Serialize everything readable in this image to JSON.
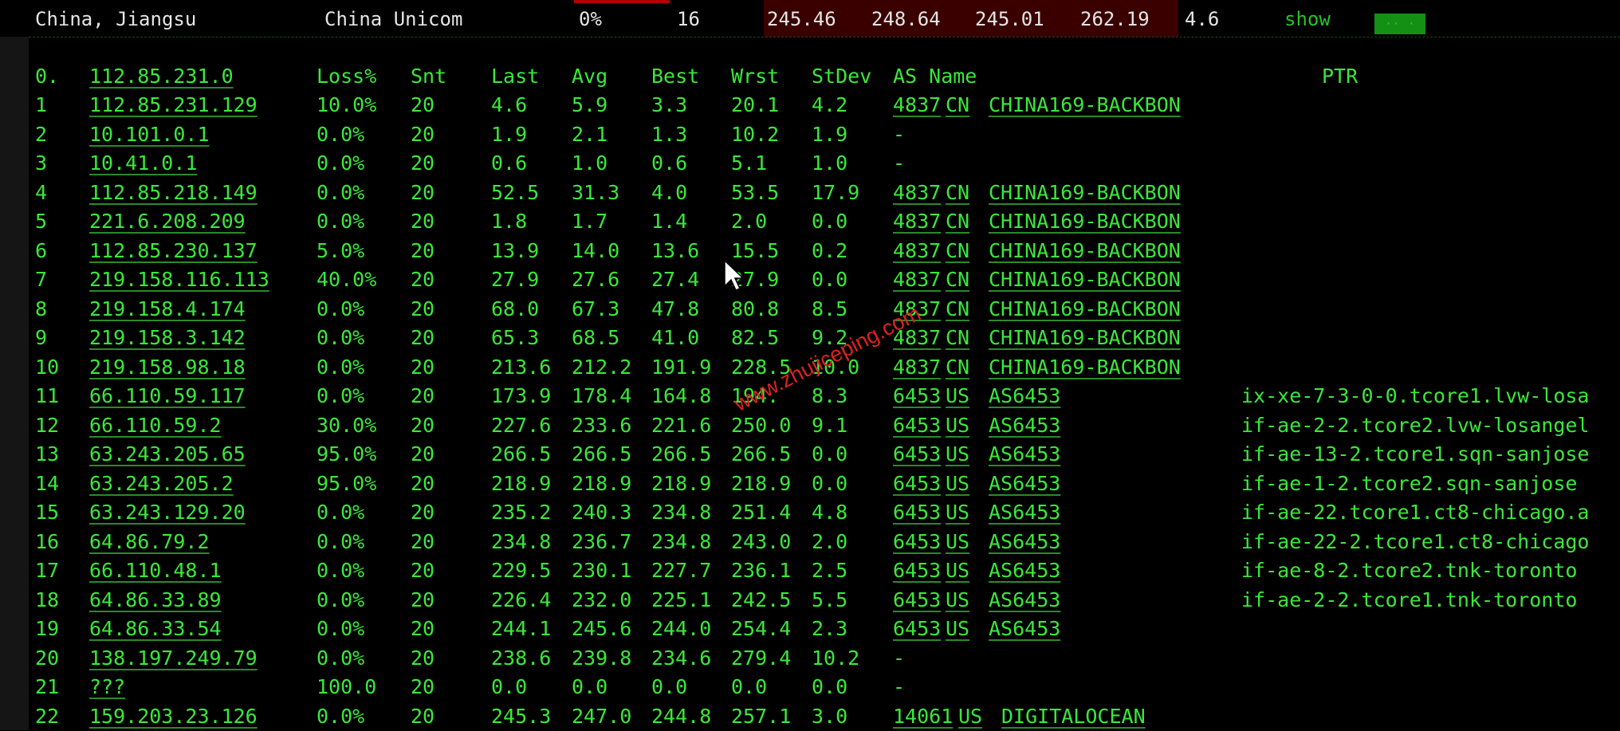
{
  "summary": {
    "location": "China, Jiangsu",
    "isp": "China Unicom",
    "loss": "0%",
    "sent": "16",
    "last": "245.46",
    "avg": "248.64",
    "best": "245.01",
    "worst": "262.19",
    "stdev": "4.6",
    "show_label": "show",
    "pill_text": "·· ·"
  },
  "columns": {
    "hop": "0.",
    "host": "112.85.231.0",
    "loss": "Loss%",
    "snt": "Snt",
    "last": "Last",
    "avg": "Avg",
    "best": "Best",
    "wrst": "Wrst",
    "stdev": "StDev",
    "as_name": "AS Name",
    "ptr": "PTR"
  },
  "hops": [
    {
      "hop": "1",
      "host": "112.85.231.129",
      "loss": "10.0%",
      "snt": "20",
      "last": "4.6",
      "avg": "5.9",
      "best": "3.3",
      "wrst": "20.1",
      "stdev": "4.2",
      "asn": "4837",
      "cc": "CN",
      "asname": "CHINA169-BACKBON",
      "ptr": ""
    },
    {
      "hop": "2",
      "host": "10.101.0.1",
      "loss": "0.0%",
      "snt": "20",
      "last": "1.9",
      "avg": "2.1",
      "best": "1.3",
      "wrst": "10.2",
      "stdev": "1.9",
      "asn": "-",
      "cc": "",
      "asname": "",
      "ptr": ""
    },
    {
      "hop": "3",
      "host": "10.41.0.1",
      "loss": "0.0%",
      "snt": "20",
      "last": "0.6",
      "avg": "1.0",
      "best": "0.6",
      "wrst": "5.1",
      "stdev": "1.0",
      "asn": "-",
      "cc": "",
      "asname": "",
      "ptr": ""
    },
    {
      "hop": "4",
      "host": "112.85.218.149",
      "loss": "0.0%",
      "snt": "20",
      "last": "52.5",
      "avg": "31.3",
      "best": "4.0",
      "wrst": "53.5",
      "stdev": "17.9",
      "asn": "4837",
      "cc": "CN",
      "asname": "CHINA169-BACKBON",
      "ptr": ""
    },
    {
      "hop": "5",
      "host": "221.6.208.209",
      "loss": "0.0%",
      "snt": "20",
      "last": "1.8",
      "avg": "1.7",
      "best": "1.4",
      "wrst": "2.0",
      "stdev": "0.0",
      "asn": "4837",
      "cc": "CN",
      "asname": "CHINA169-BACKBON",
      "ptr": ""
    },
    {
      "hop": "6",
      "host": "112.85.230.137",
      "loss": "5.0%",
      "snt": "20",
      "last": "13.9",
      "avg": "14.0",
      "best": "13.6",
      "wrst": "15.5",
      "stdev": "0.2",
      "asn": "4837",
      "cc": "CN",
      "asname": "CHINA169-BACKBON",
      "ptr": ""
    },
    {
      "hop": "7",
      "host": "219.158.116.113",
      "loss": "40.0%",
      "snt": "20",
      "last": "27.9",
      "avg": "27.6",
      "best": "27.4",
      "wrst": "27.9",
      "stdev": "0.0",
      "asn": "4837",
      "cc": "CN",
      "asname": "CHINA169-BACKBON",
      "ptr": ""
    },
    {
      "hop": "8",
      "host": "219.158.4.174",
      "loss": "0.0%",
      "snt": "20",
      "last": "68.0",
      "avg": "67.3",
      "best": "47.8",
      "wrst": "80.8",
      "stdev": "8.5",
      "asn": "4837",
      "cc": "CN",
      "asname": "CHINA169-BACKBON",
      "ptr": ""
    },
    {
      "hop": "9",
      "host": "219.158.3.142",
      "loss": "0.0%",
      "snt": "20",
      "last": "65.3",
      "avg": "68.5",
      "best": "41.0",
      "wrst": "82.5",
      "stdev": "9.2",
      "asn": "4837",
      "cc": "CN",
      "asname": "CHINA169-BACKBON",
      "ptr": ""
    },
    {
      "hop": "10",
      "host": "219.158.98.18",
      "loss": "0.0%",
      "snt": "20",
      "last": "213.6",
      "avg": "212.2",
      "best": "191.9",
      "wrst": "228.5",
      "stdev": "10.0",
      "asn": "4837",
      "cc": "CN",
      "asname": "CHINA169-BACKBON",
      "ptr": ""
    },
    {
      "hop": "11",
      "host": "66.110.59.117",
      "loss": "0.0%",
      "snt": "20",
      "last": "173.9",
      "avg": "178.4",
      "best": "164.8",
      "wrst": "194.",
      "stdev": "8.3",
      "asn": "6453",
      "cc": "US",
      "asname": "AS6453",
      "ptr": "ix-xe-7-3-0-0.tcore1.lvw-losa"
    },
    {
      "hop": "12",
      "host": "66.110.59.2",
      "loss": "30.0%",
      "snt": "20",
      "last": "227.6",
      "avg": "233.6",
      "best": "221.6",
      "wrst": "250.0",
      "stdev": "9.1",
      "asn": "6453",
      "cc": "US",
      "asname": "AS6453",
      "ptr": "if-ae-2-2.tcore2.lvw-losangel"
    },
    {
      "hop": "13",
      "host": "63.243.205.65",
      "loss": "95.0%",
      "snt": "20",
      "last": "266.5",
      "avg": "266.5",
      "best": "266.5",
      "wrst": "266.5",
      "stdev": "0.0",
      "asn": "6453",
      "cc": "US",
      "asname": "AS6453",
      "ptr": "if-ae-13-2.tcore1.sqn-sanjose"
    },
    {
      "hop": "14",
      "host": "63.243.205.2",
      "loss": "95.0%",
      "snt": "20",
      "last": "218.9",
      "avg": "218.9",
      "best": "218.9",
      "wrst": "218.9",
      "stdev": "0.0",
      "asn": "6453",
      "cc": "US",
      "asname": "AS6453",
      "ptr": "if-ae-1-2.tcore2.sqn-sanjose"
    },
    {
      "hop": "15",
      "host": "63.243.129.20",
      "loss": "0.0%",
      "snt": "20",
      "last": "235.2",
      "avg": "240.3",
      "best": "234.8",
      "wrst": "251.4",
      "stdev": "4.8",
      "asn": "6453",
      "cc": "US",
      "asname": "AS6453",
      "ptr": "if-ae-22.tcore1.ct8-chicago.a"
    },
    {
      "hop": "16",
      "host": "64.86.79.2",
      "loss": "0.0%",
      "snt": "20",
      "last": "234.8",
      "avg": "236.7",
      "best": "234.8",
      "wrst": "243.0",
      "stdev": "2.0",
      "asn": "6453",
      "cc": "US",
      "asname": "AS6453",
      "ptr": "if-ae-22-2.tcore1.ct8-chicago"
    },
    {
      "hop": "17",
      "host": "66.110.48.1",
      "loss": "0.0%",
      "snt": "20",
      "last": "229.5",
      "avg": "230.1",
      "best": "227.7",
      "wrst": "236.1",
      "stdev": "2.5",
      "asn": "6453",
      "cc": "US",
      "asname": "AS6453",
      "ptr": "if-ae-8-2.tcore2.tnk-toronto"
    },
    {
      "hop": "18",
      "host": "64.86.33.89",
      "loss": "0.0%",
      "snt": "20",
      "last": "226.4",
      "avg": "232.0",
      "best": "225.1",
      "wrst": "242.5",
      "stdev": "5.5",
      "asn": "6453",
      "cc": "US",
      "asname": "AS6453",
      "ptr": "if-ae-2-2.tcore1.tnk-toronto"
    },
    {
      "hop": "19",
      "host": "64.86.33.54",
      "loss": "0.0%",
      "snt": "20",
      "last": "244.1",
      "avg": "245.6",
      "best": "244.0",
      "wrst": "254.4",
      "stdev": "2.3",
      "asn": "6453",
      "cc": "US",
      "asname": "AS6453",
      "ptr": ""
    },
    {
      "hop": "20",
      "host": "138.197.249.79",
      "loss": "0.0%",
      "snt": "20",
      "last": "238.6",
      "avg": "239.8",
      "best": "234.6",
      "wrst": "279.4",
      "stdev": "10.2",
      "asn": "-",
      "cc": "",
      "asname": "",
      "ptr": ""
    },
    {
      "hop": "21",
      "host": "???",
      "loss": "100.0",
      "snt": "20",
      "last": "0.0",
      "avg": "0.0",
      "best": "0.0",
      "wrst": "0.0",
      "stdev": "0.0",
      "asn": "-",
      "cc": "",
      "asname": "",
      "ptr": ""
    },
    {
      "hop": "22",
      "host": "159.203.23.126",
      "loss": "0.0%",
      "snt": "20",
      "last": "245.3",
      "avg": "247.0",
      "best": "244.8",
      "wrst": "257.1",
      "stdev": "3.0",
      "asn": "14061",
      "cc": "US",
      "asname": "DIGITALOCEAN",
      "ptr": ""
    }
  ],
  "watermark": "www.zhujiceping.com",
  "colors": {
    "text_green": "#3ae83a",
    "link_green": "#22c622",
    "bar_red": "#b40000",
    "watermark_red": "#e02020"
  },
  "icons": {
    "cursor": "mouse-pointer-icon"
  }
}
